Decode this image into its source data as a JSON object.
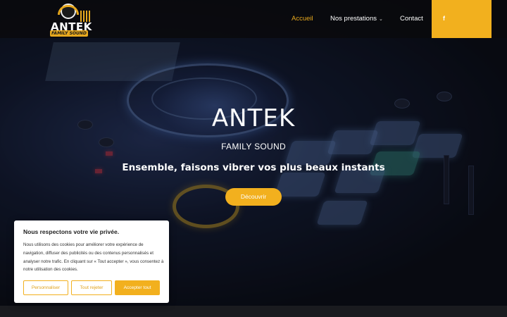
{
  "colors": {
    "accent": "#f2b01e",
    "header_bg": "#0a0a0c",
    "cookie_bg": "#ffffff"
  },
  "logo": {
    "text": "ANTEK",
    "subtext": "FAMILY SOUND"
  },
  "nav": {
    "home": "Accueil",
    "services": "Nos prestations",
    "contact": "Contact",
    "facebook_icon": "f"
  },
  "hero": {
    "title": "ANTEK",
    "subtitle": "FAMILY SOUND",
    "tagline": "Ensemble, faisons vibrer vos plus beaux instants",
    "cta": "Découvrir"
  },
  "cookie": {
    "title": "Nous respectons votre vie privée.",
    "text": "Nous utilisons des cookies pour améliorer votre expérience de navigation, diffuser des publicités ou des contenus personnalisés et analyser notre trafic. En cliquant sur « Tout accepter », vous consentez à notre utilisation des cookies.",
    "customize": "Personnaliser",
    "reject": "Tout rejeter",
    "accept": "Accepter tout"
  }
}
